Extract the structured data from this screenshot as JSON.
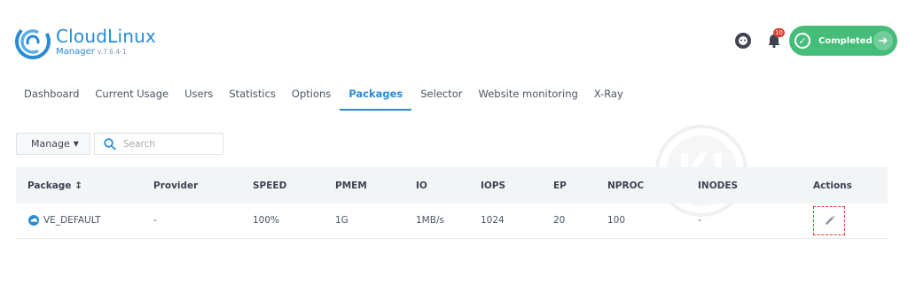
{
  "brand": {
    "name": "CloudLinux",
    "product": "Manager",
    "version": "v.7.6.4-1"
  },
  "header": {
    "notifications_count": "10",
    "status_label": "Completed",
    "icons": [
      "support-icon",
      "bell-icon",
      "check-circle-icon",
      "arrow-right-icon"
    ]
  },
  "tabs": [
    {
      "label": "Dashboard",
      "active": false
    },
    {
      "label": "Current Usage",
      "active": false
    },
    {
      "label": "Users",
      "active": false
    },
    {
      "label": "Statistics",
      "active": false
    },
    {
      "label": "Options",
      "active": false
    },
    {
      "label": "Packages",
      "active": true
    },
    {
      "label": "Selector",
      "active": false
    },
    {
      "label": "Website monitoring",
      "active": false
    },
    {
      "label": "X-Ray",
      "active": false
    }
  ],
  "toolbar": {
    "manage_label": "Manage",
    "search_placeholder": "Search"
  },
  "table": {
    "columns": [
      "Package",
      "Provider",
      "SPEED",
      "PMEM",
      "IO",
      "IOPS",
      "EP",
      "NPROC",
      "INODES",
      "Actions"
    ],
    "rows": [
      {
        "package": "VE_DEFAULT",
        "provider": "-",
        "speed": "100%",
        "pmem": "1G",
        "io": "1MB/s",
        "iops": "1024",
        "ep": "20",
        "nproc": "100",
        "inodes": "-"
      }
    ]
  },
  "colors": {
    "accent": "#2a8bd4",
    "success": "#45bd79",
    "danger": "#e0392b"
  }
}
